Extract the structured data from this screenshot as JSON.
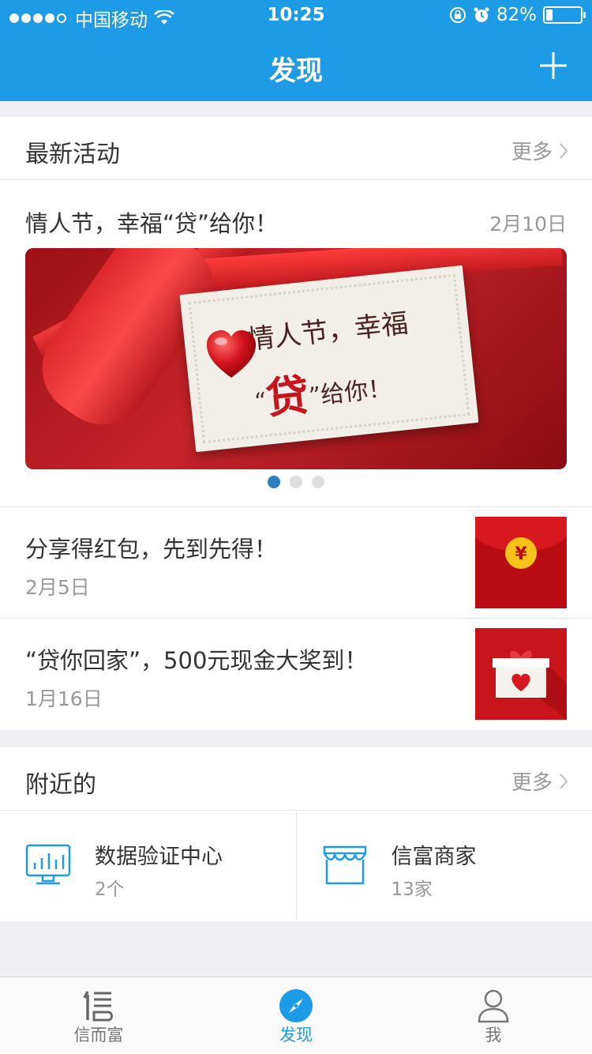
{
  "status_bar": {
    "carrier": "中国移动",
    "time": "10:25",
    "battery": "82%"
  },
  "navbar": {
    "title": "发现"
  },
  "activities": {
    "title": "最新活动",
    "more": "更多",
    "featured": {
      "title": "情人节，幸福“贷”给你！",
      "date": "2月10日",
      "banner_line1": "情人节，幸福",
      "banner_quote_open": "“",
      "banner_dai": "贷",
      "banner_quote_close": "”给你！"
    },
    "items": [
      {
        "title": "分享得红包，先到先得！",
        "date": "2月5日",
        "icon": "red-envelope-icon"
      },
      {
        "title": "“贷你回家”，500元现金大奖到！",
        "date": "1月16日",
        "icon": "gift-box-icon"
      }
    ]
  },
  "nearby": {
    "title": "附近的",
    "more": "更多",
    "items": [
      {
        "name": "数据验证中心",
        "count": "2个",
        "icon": "monitor-chart-icon"
      },
      {
        "name": "信富商家",
        "count": "13家",
        "icon": "store-icon"
      }
    ]
  },
  "tabbar": {
    "items": [
      {
        "label": "信而富",
        "icon": "xin-logo-icon",
        "active": false
      },
      {
        "label": "发现",
        "icon": "compass-icon",
        "active": true
      },
      {
        "label": "我",
        "icon": "person-icon",
        "active": false
      }
    ]
  },
  "colors": {
    "brand_blue": "#1e9be6",
    "pager_active": "#2b7fc1",
    "red": "#c4161c"
  }
}
